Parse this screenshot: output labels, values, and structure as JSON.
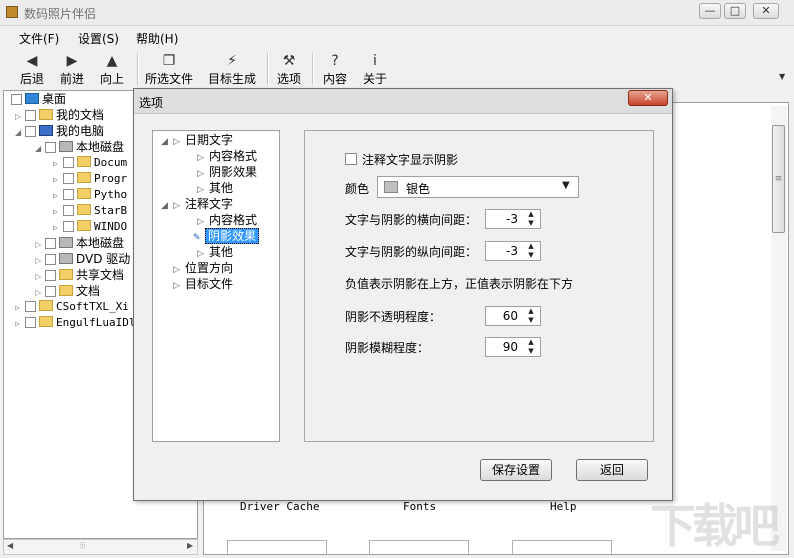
{
  "app": {
    "title": "数码照片伴侣"
  },
  "window_controls": {
    "minimize": "—",
    "maximize": "□",
    "close": "✕"
  },
  "menu": [
    {
      "label": "文件(F)"
    },
    {
      "label": "设置(S)"
    },
    {
      "label": "帮助(H)"
    }
  ],
  "toolbar": [
    {
      "label": "后退",
      "icon": "◀"
    },
    {
      "label": "前进",
      "icon": "▶"
    },
    {
      "label": "向上",
      "icon": "▲"
    },
    {
      "label": "所选文件",
      "icon": "❐"
    },
    {
      "label": "目标生成",
      "icon": "⚡"
    },
    {
      "label": "选项",
      "icon": "⚒"
    },
    {
      "label": "内容",
      "icon": "?"
    },
    {
      "label": "关于",
      "icon": "i"
    }
  ],
  "tree": [
    {
      "label": "桌面",
      "icon": "desktop-icon"
    },
    {
      "label": "我的文档",
      "icon": "documents-icon"
    },
    {
      "label": "我的电脑",
      "icon": "computer-icon"
    },
    {
      "label": "本地磁盘",
      "icon": "drive-icon"
    },
    {
      "label": "Docum",
      "icon": "folder-icon"
    },
    {
      "label": "Progr",
      "icon": "folder-icon"
    },
    {
      "label": "Pytho",
      "icon": "folder-icon"
    },
    {
      "label": "StarB",
      "icon": "folder-icon"
    },
    {
      "label": "WINDO",
      "icon": "folder-icon"
    },
    {
      "label": "本地磁盘",
      "icon": "drive-icon"
    },
    {
      "label": "DVD 驱动",
      "icon": "dvd-icon"
    },
    {
      "label": "共享文档",
      "icon": "folder-icon"
    },
    {
      "label": "文档",
      "icon": "folder-icon"
    },
    {
      "label": "CSoftTXL_Xi",
      "icon": "folder-icon"
    },
    {
      "label": "EngulfLuaIDl",
      "icon": "folder-icon"
    }
  ],
  "bottom_labels": [
    "Driver Cache",
    "Fonts",
    "Help"
  ],
  "dialog": {
    "title": "选项",
    "close": "✕",
    "options_tree": [
      {
        "label": "日期文字"
      },
      {
        "label": "内容格式"
      },
      {
        "label": "阴影效果"
      },
      {
        "label": "其他"
      },
      {
        "label": "注释文字"
      },
      {
        "label": "内容格式"
      },
      {
        "label": "阴影效果",
        "selected": true
      },
      {
        "label": "其他"
      },
      {
        "label": "位置方向"
      },
      {
        "label": "目标文件"
      }
    ],
    "shadow_checkbox_label": "注释文字显示阴影",
    "shadow_checked": false,
    "color_label": "颜色",
    "color_value": "银色",
    "color_swatch": "#c0c0c0",
    "h_offset_label": "文字与阴影的横向间距：",
    "h_offset_value": "-3",
    "v_offset_label": "文字与阴影的纵向间距：",
    "v_offset_value": "-3",
    "note": "负值表示阴影在上方，正值表示阴影在下方",
    "opacity_label": "阴影不透明程度：",
    "opacity_value": "60",
    "blur_label": "阴影模糊程度：",
    "blur_value": "90",
    "save_button": "保存设置",
    "back_button": "返回"
  },
  "watermark": "下载吧"
}
